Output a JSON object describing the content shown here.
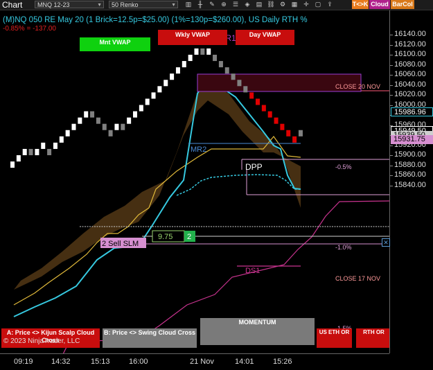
{
  "toolbar": {
    "window_title": "Chart",
    "instrument": "MNQ 12-23",
    "period": "50 Renko",
    "buttons": [
      {
        "label": "T<>K",
        "color": "#e87b1d"
      },
      {
        "label": "Cloud",
        "color": "#b0208c"
      },
      {
        "label": "BarCol",
        "color": "#d9791a"
      }
    ]
  },
  "chart_header": {
    "title": "(M)NQ 050 RE May 20 (1 Brick=12.5p=$25.00) (1%=130p=$260.00), US Daily RTH %",
    "pnl": "-0.85% = -137.00"
  },
  "overlay_buttons": {
    "mnt_vwap": "Mnt VWAP",
    "wkly_vwap": "Wkly VWAP",
    "day_vwap": "Day VWAP",
    "a_label": "A: Price <> Kijun Scalp Cloud Cross",
    "b_label": "B: Price <> Swing Cloud Cross",
    "momentum": "MOMENTUM",
    "us_eth_or": "US ETH OR",
    "rth_or": "RTH OR"
  },
  "annotations": {
    "wr1": "WR1",
    "close_20_nov": "CLOSE 20 NOV",
    "mr2": "MR2",
    "dpp": "DPP",
    "pct_neg05": "-0.5%",
    "pct_neg1": "-1.0%",
    "pct_neg15": "-1.5%",
    "close_17_nov": "CLOSE 17 NOV",
    "ds1": "DS1",
    "sell_signal": "2 Sell SLM",
    "box_value": "9.75",
    "box_count": "2",
    "copyright": "© 2023 NinjaTrader, LLC"
  },
  "colors": {
    "up_brick": "#ffffff",
    "down_brick": "#e00000",
    "neutral_brick": "#808080",
    "cloud": "#4a3113",
    "cyan_line": "#36c9e0",
    "magenta_line": "#c9338f",
    "gold_line": "#e0b93a",
    "price_badge": "#d68fd0"
  },
  "chart_data": {
    "type": "renko",
    "y_axis": {
      "ticks": [
        16140,
        16120,
        16100,
        16080,
        16060,
        16040,
        16020,
        16000,
        15980,
        15960,
        15940,
        15920,
        15900,
        15880,
        15860,
        15840
      ]
    },
    "x_axis": {
      "tick_labels": [
        "09:19",
        "14:32",
        "15:13",
        "16:00",
        "21 Nov",
        "14:01",
        "15:26"
      ]
    },
    "price_labels": [
      {
        "value": "15986.96",
        "color": "#36c9e0"
      },
      {
        "value": "15949.50",
        "color": "#ffffff"
      },
      {
        "value": "15939.50",
        "color": "#cfcfcf"
      },
      {
        "value": "15931.75",
        "color": "#d68fd0"
      }
    ],
    "bricks": [
      {
        "open": 15887.5,
        "close": 15875,
        "dir": "up"
      },
      {
        "open": 15887.5,
        "close": 15900,
        "dir": "up"
      },
      {
        "open": 15900,
        "close": 15912.5,
        "dir": "up"
      },
      {
        "open": 15912.5,
        "close": 15900,
        "dir": "neutral"
      },
      {
        "open": 15900,
        "close": 15912.5,
        "dir": "up"
      },
      {
        "open": 15912.5,
        "close": 15925,
        "dir": "up"
      },
      {
        "open": 15912.5,
        "close": 15900,
        "dir": "neutral"
      },
      {
        "open": 15912.5,
        "close": 15925,
        "dir": "up"
      },
      {
        "open": 15925,
        "close": 15937.5,
        "dir": "up"
      },
      {
        "open": 15937.5,
        "close": 15950,
        "dir": "up"
      },
      {
        "open": 15950,
        "close": 15962.5,
        "dir": "up"
      },
      {
        "open": 15962.5,
        "close": 15975,
        "dir": "up"
      },
      {
        "open": 15975,
        "close": 15987.5,
        "dir": "up"
      },
      {
        "open": 15987.5,
        "close": 15975,
        "dir": "neutral"
      },
      {
        "open": 15975,
        "close": 15962.5,
        "dir": "neutral"
      },
      {
        "open": 15962.5,
        "close": 15950,
        "dir": "neutral"
      },
      {
        "open": 15950,
        "close": 15937.5,
        "dir": "neutral"
      },
      {
        "open": 15950,
        "close": 15962.5,
        "dir": "up"
      },
      {
        "open": 15962.5,
        "close": 15950,
        "dir": "neutral"
      },
      {
        "open": 15962.5,
        "close": 15975,
        "dir": "up"
      },
      {
        "open": 15975,
        "close": 15987.5,
        "dir": "up"
      },
      {
        "open": 15987.5,
        "close": 16000,
        "dir": "up"
      },
      {
        "open": 16000,
        "close": 16012.5,
        "dir": "up"
      },
      {
        "open": 16012.5,
        "close": 16025,
        "dir": "up"
      },
      {
        "open": 16025,
        "close": 16037.5,
        "dir": "up"
      },
      {
        "open": 16037.5,
        "close": 16050,
        "dir": "up"
      },
      {
        "open": 16050,
        "close": 16062.5,
        "dir": "up"
      },
      {
        "open": 16062.5,
        "close": 16075,
        "dir": "up"
      },
      {
        "open": 16075,
        "close": 16087.5,
        "dir": "up"
      },
      {
        "open": 16087.5,
        "close": 16100,
        "dir": "up"
      },
      {
        "open": 16100,
        "close": 16112.5,
        "dir": "up"
      },
      {
        "open": 16112.5,
        "close": 16100,
        "dir": "neutral"
      },
      {
        "open": 16100,
        "close": 16112.5,
        "dir": "up"
      },
      {
        "open": 16100,
        "close": 16087.5,
        "dir": "neutral"
      },
      {
        "open": 16087.5,
        "close": 16075,
        "dir": "neutral"
      },
      {
        "open": 16075,
        "close": 16062.5,
        "dir": "neutral"
      },
      {
        "open": 16062.5,
        "close": 16050,
        "dir": "neutral"
      },
      {
        "open": 16050,
        "close": 16037.5,
        "dir": "neutral"
      },
      {
        "open": 16037.5,
        "close": 16025,
        "dir": "neutral"
      },
      {
        "open": 16025,
        "close": 16012.5,
        "dir": "down"
      },
      {
        "open": 16012.5,
        "close": 16000,
        "dir": "down"
      },
      {
        "open": 16000,
        "close": 15987.5,
        "dir": "down"
      },
      {
        "open": 15987.5,
        "close": 15975,
        "dir": "down"
      },
      {
        "open": 15975,
        "close": 15962.5,
        "dir": "down"
      },
      {
        "open": 15962.5,
        "close": 15950,
        "dir": "down"
      },
      {
        "open": 15950,
        "close": 15937.5,
        "dir": "down"
      },
      {
        "open": 15937.5,
        "close": 15925,
        "dir": "down"
      },
      {
        "open": 15937.5,
        "close": 15950,
        "dir": "neutral"
      }
    ]
  }
}
